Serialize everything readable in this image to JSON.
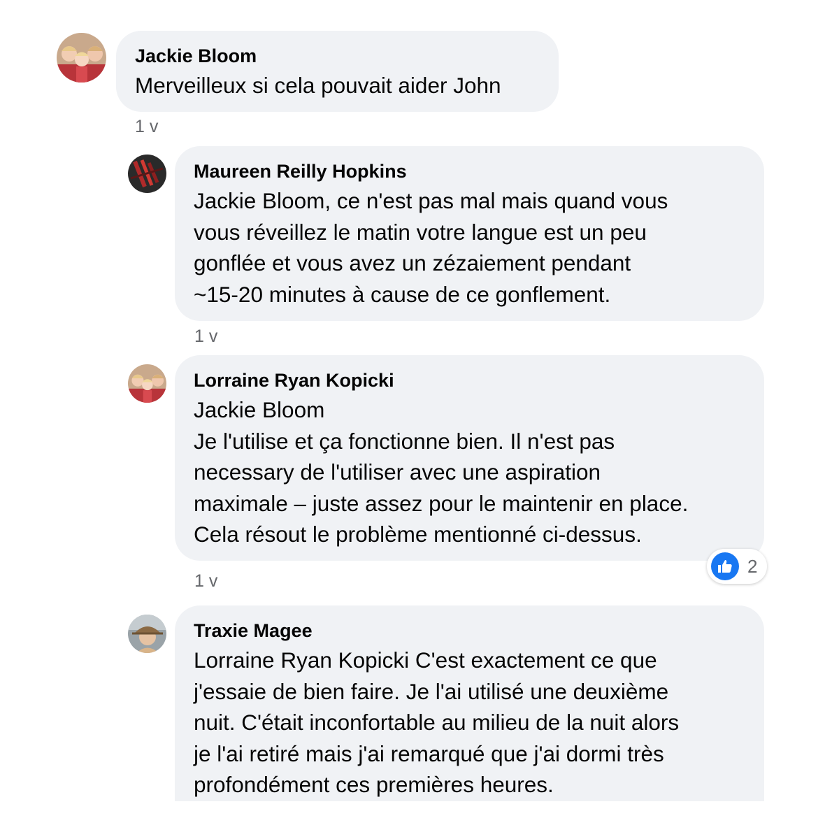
{
  "comments": [
    {
      "author": "Jackie Bloom",
      "text": "Merveilleux si cela pouvait aider John",
      "time": "1 v",
      "avatar": "family-photo-avatar"
    },
    {
      "author": "Maureen Reilly Hopkins",
      "text": "Jackie Bloom, ce n'est pas mal mais quand vous\nvous réveillez le matin votre langue est un peu\ngonflée et vous avez un zézaiement pendant\n~15-20 minutes à cause de ce gonflement.",
      "time": "1 v",
      "avatar": "dark-red-abstract-avatar"
    },
    {
      "author": "Lorraine Ryan Kopicki",
      "text": "Jackie Bloom\nJe l'utilise et ça fonctionne bien. Il n'est pas\nnecessary de l'utiliser avec une aspiration\nmaximale – juste assez pour le maintenir en place.\nCela résout le problème mentionné ci-dessus.",
      "time": "1 v",
      "avatar": "family-photo-avatar",
      "reactions": {
        "icon": "thumbs-up-icon",
        "count": "2",
        "color": "#1877f2"
      }
    },
    {
      "author": "Traxie Magee",
      "text": "Lorraine Ryan Kopicki C'est exactement ce que\nj'essaie de bien faire. Je l'ai utilisé une deuxième\nnuit. C'était inconfortable au milieu de la nuit alors\nje l'ai retiré mais j'ai remarqué que j'ai dormi très\nprofondément ces premières heures.",
      "avatar": "person-with-hat-avatar"
    }
  ],
  "colors": {
    "bubble": "#f0f2f5",
    "text": "#050505",
    "secondary_text": "#65676b",
    "like_blue": "#1877f2"
  }
}
